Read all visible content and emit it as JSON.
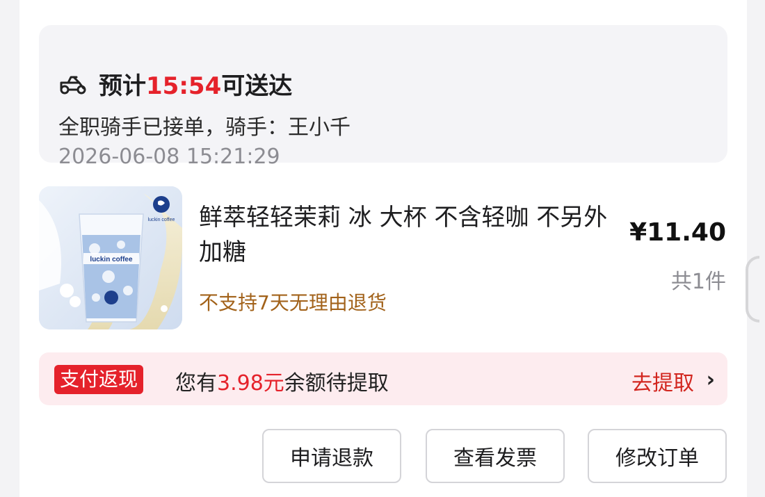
{
  "delivery": {
    "eta_prefix": "预计",
    "eta_time": "15:54",
    "eta_suffix": "可送达",
    "rider_status": "全职骑手已接单，骑手：王小千",
    "timestamp": "2026-06-08 15:21:29"
  },
  "product": {
    "name": "鲜萃轻轻茉莉 冰 大杯 不含轻咖 不另外加糖",
    "policy": "不支持7天无理由退货",
    "price": "¥11.40",
    "quantity": "共1件",
    "image": {
      "brand_text": "luckin coffee",
      "cup_text": "luckin coffee"
    }
  },
  "cashback": {
    "badge": "支付返现",
    "text_prefix": "您有",
    "amount": "3.98元",
    "text_suffix": "余额待提取",
    "action": "去提取",
    "chevron": "›"
  },
  "actions": {
    "refund": "申请退款",
    "invoice": "查看发票",
    "modify": "修改订单"
  },
  "icons": {
    "delivery": "scooter-icon",
    "chevron": "chevron-right-icon"
  },
  "colors": {
    "accent_red": "#e5222b",
    "policy_brown": "#a2621a",
    "delivery_bg": "#f4f4f7",
    "cashback_bg": "#fdecef",
    "brand_blue": "#1d3f8c"
  }
}
